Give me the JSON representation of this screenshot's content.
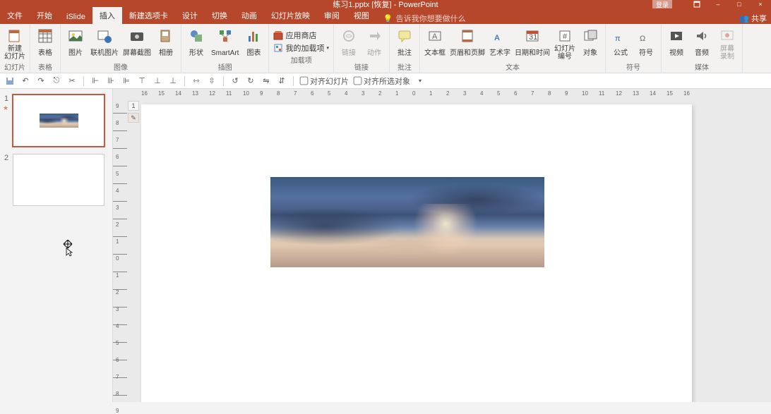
{
  "colors": {
    "brand": "#b7472a",
    "accent": "#c55a3c"
  },
  "titlebar": {
    "document": "练习1.pptx [恢复]",
    "app": "PowerPoint",
    "login": "登录",
    "window_icon_label": "展开功能区",
    "minimize": "–",
    "maximize": "□",
    "close": "×"
  },
  "menus": [
    {
      "id": "file",
      "label": "文件"
    },
    {
      "id": "home",
      "label": "开始"
    },
    {
      "id": "islide",
      "label": "iSlide"
    },
    {
      "id": "insert",
      "label": "插入",
      "active": true
    },
    {
      "id": "newtab",
      "label": "新建选项卡"
    },
    {
      "id": "design",
      "label": "设计"
    },
    {
      "id": "transitions",
      "label": "切换"
    },
    {
      "id": "animations",
      "label": "动画"
    },
    {
      "id": "slideshow",
      "label": "幻灯片放映"
    },
    {
      "id": "review",
      "label": "审阅"
    },
    {
      "id": "view",
      "label": "视图"
    }
  ],
  "tell_me": "告诉我你想要做什么",
  "share": "共享",
  "ribbon": {
    "groups": [
      {
        "id": "slides",
        "label": "幻灯片",
        "items": [
          {
            "id": "new-slide",
            "label": "新建\n幻灯片"
          }
        ]
      },
      {
        "id": "tables",
        "label": "表格",
        "items": [
          {
            "id": "table",
            "label": "表格"
          }
        ]
      },
      {
        "id": "images",
        "label": "图像",
        "items": [
          {
            "id": "picture",
            "label": "图片"
          },
          {
            "id": "online-picture",
            "label": "联机图片"
          },
          {
            "id": "screenshot",
            "label": "屏幕截图"
          },
          {
            "id": "photo-album",
            "label": "相册"
          }
        ]
      },
      {
        "id": "illustrations",
        "label": "插图",
        "items": [
          {
            "id": "shapes",
            "label": "形状"
          },
          {
            "id": "smartart",
            "label": "SmartArt"
          },
          {
            "id": "chart",
            "label": "图表"
          }
        ]
      },
      {
        "id": "addins",
        "label": "加载项",
        "stack": [
          {
            "id": "office-store",
            "label": "应用商店"
          },
          {
            "id": "my-addins",
            "label": "我的加载项"
          }
        ]
      },
      {
        "id": "links",
        "label": "链接",
        "items": [
          {
            "id": "hyperlink",
            "label": "链接",
            "disabled": true
          },
          {
            "id": "action",
            "label": "动作",
            "disabled": true
          }
        ]
      },
      {
        "id": "comments",
        "label": "批注",
        "items": [
          {
            "id": "comment",
            "label": "批注"
          }
        ]
      },
      {
        "id": "text",
        "label": "文本",
        "items": [
          {
            "id": "textbox",
            "label": "文本框"
          },
          {
            "id": "header-footer",
            "label": "页眉和页脚"
          },
          {
            "id": "wordart",
            "label": "艺术字"
          },
          {
            "id": "datetime",
            "label": "日期和时间"
          },
          {
            "id": "slidenumber",
            "label": "幻灯片\n编号"
          },
          {
            "id": "object",
            "label": "对象"
          }
        ]
      },
      {
        "id": "symbols",
        "label": "符号",
        "items": [
          {
            "id": "equation",
            "label": "公式"
          },
          {
            "id": "symbol",
            "label": "符号"
          }
        ]
      },
      {
        "id": "media",
        "label": "媒体",
        "items": [
          {
            "id": "video",
            "label": "视频"
          },
          {
            "id": "audio",
            "label": "音频"
          },
          {
            "id": "screen-recording",
            "label": "屏幕\n录制",
            "disabled": true
          }
        ]
      }
    ]
  },
  "qat": {
    "align_slide": "对齐幻灯片",
    "align_selected": "对齐所选对象"
  },
  "ruler_h": [
    "16",
    "15",
    "14",
    "13",
    "12",
    "11",
    "10",
    "9",
    "8",
    "7",
    "6",
    "5",
    "4",
    "3",
    "2",
    "1",
    "0",
    "1",
    "2",
    "3",
    "4",
    "5",
    "6",
    "7",
    "8",
    "9",
    "10",
    "11",
    "12",
    "13",
    "14",
    "15",
    "16"
  ],
  "ruler_v": [
    "9",
    "8",
    "7",
    "6",
    "5",
    "4",
    "3",
    "2",
    "1",
    "0",
    "1",
    "2",
    "3",
    "4",
    "5",
    "6",
    "7",
    "8",
    "9"
  ],
  "slides": [
    {
      "num": "1",
      "active": true,
      "has_image": true,
      "has_animation": true
    },
    {
      "num": "2",
      "active": false,
      "has_image": false,
      "has_animation": false
    }
  ],
  "side_handle": {
    "one": "1",
    "brush": "✎"
  }
}
